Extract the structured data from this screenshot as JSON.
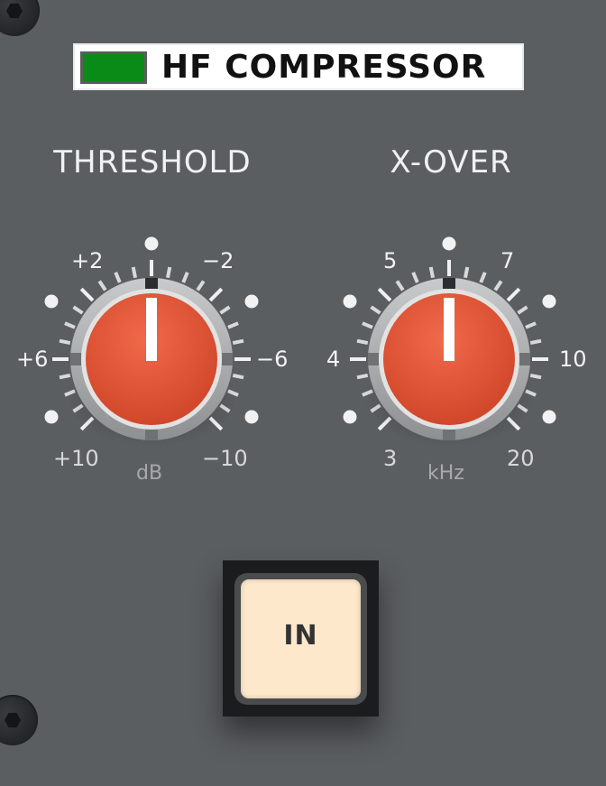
{
  "header": {
    "title": "HF COMPRESSOR",
    "led_color": "#0a8a17"
  },
  "threshold": {
    "title": "THRESHOLD",
    "unit": "dB",
    "labels": {
      "p2": "+2",
      "m2": "−2",
      "p6": "+6",
      "m6": "−6",
      "p10": "+10",
      "m10": "−10"
    },
    "knob_color": "#e0553a"
  },
  "xover": {
    "title": "X-OVER",
    "unit": "kHz",
    "labels": {
      "v5": "5",
      "v7": "7",
      "v4": "4",
      "v10": "10",
      "v3": "3",
      "v20": "20"
    },
    "knob_color": "#e0553a"
  },
  "in_button": {
    "label": "IN",
    "face_color": "#fde8cc"
  }
}
